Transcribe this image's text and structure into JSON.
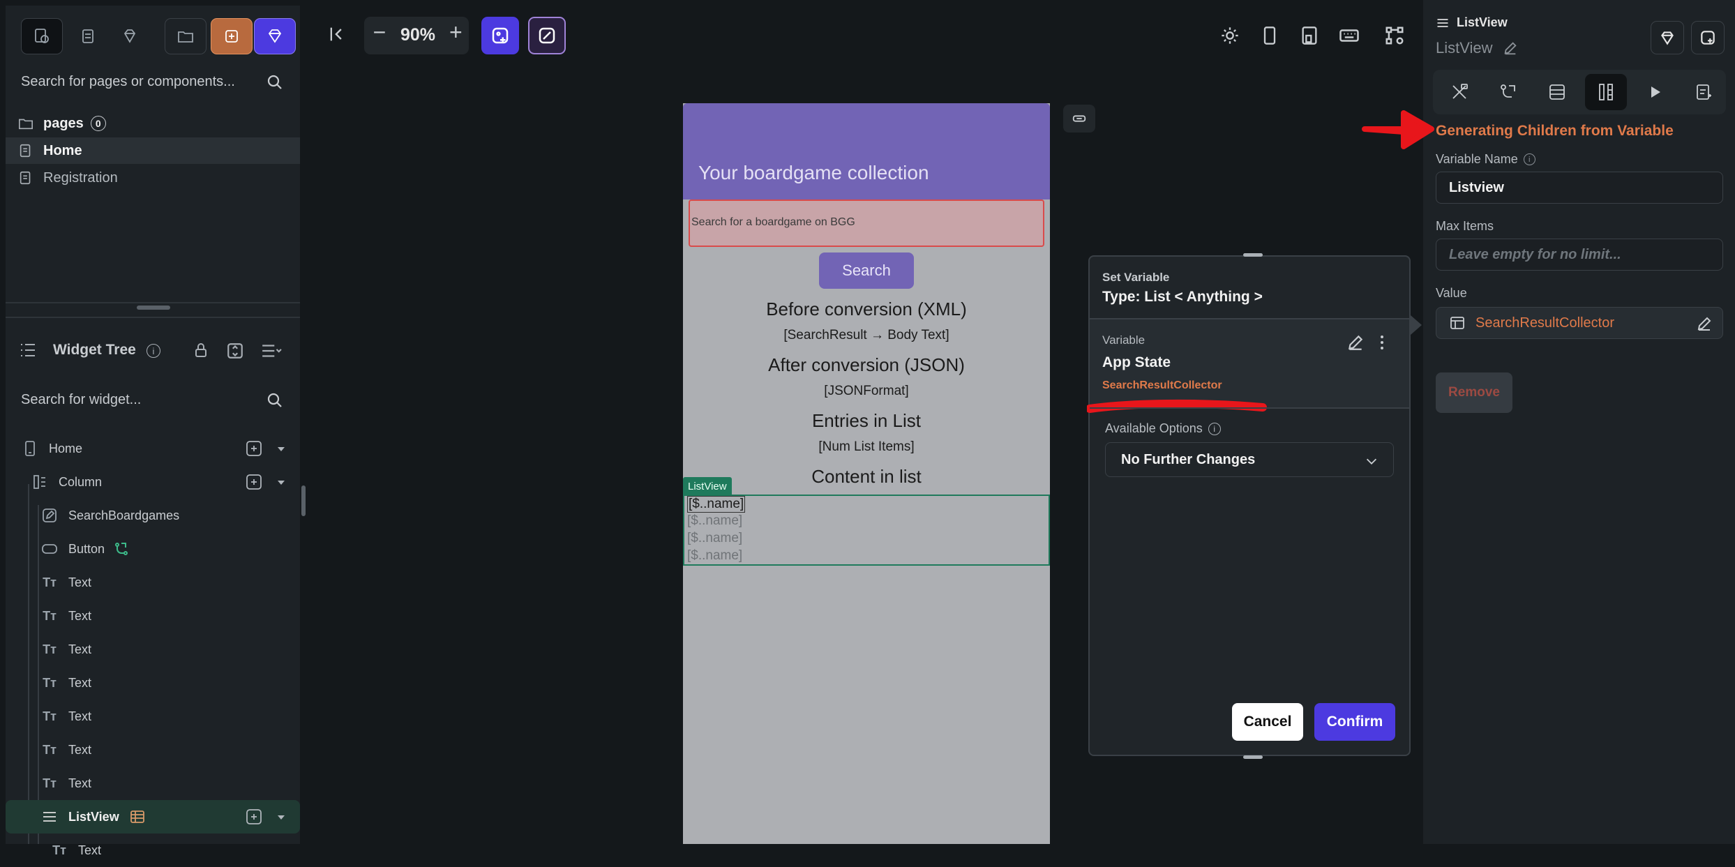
{
  "left_panel": {
    "search_pages_placeholder": "Search for pages or components...",
    "pages_label": "pages",
    "pages_count": "0",
    "pages": [
      "Home",
      "Registration"
    ],
    "widget_tree_title": "Widget Tree",
    "search_widget_placeholder": "Search for widget...",
    "tree": [
      {
        "label": "Home",
        "icon": "phone-icon"
      },
      {
        "label": "Column",
        "icon": "column-icon"
      },
      {
        "label": "SearchBoardgames",
        "icon": "textfield-icon"
      },
      {
        "label": "Button",
        "icon": "button-icon"
      },
      {
        "label": "Text",
        "icon": "text-icon"
      },
      {
        "label": "Text",
        "icon": "text-icon"
      },
      {
        "label": "Text",
        "icon": "text-icon"
      },
      {
        "label": "Text",
        "icon": "text-icon"
      },
      {
        "label": "Text",
        "icon": "text-icon"
      },
      {
        "label": "Text",
        "icon": "text-icon"
      },
      {
        "label": "Text",
        "icon": "text-icon"
      },
      {
        "label": "ListView",
        "icon": "listview-icon"
      },
      {
        "label": "Text",
        "icon": "text-icon"
      }
    ]
  },
  "canvas": {
    "zoom": "90%",
    "minus": "−",
    "plus": "+",
    "phone": {
      "app_title": "Your boardgame collection",
      "search_placeholder": "Search for a boardgame on BGG",
      "search_button": "Search",
      "texts": [
        "Before conversion (XML)",
        "[SearchResult → Body Text]",
        "After conversion (JSON)",
        "[JSONFormat]",
        "Entries in List",
        "[Num List Items]",
        "Content in list"
      ],
      "listview_badge": "ListView",
      "list_items": [
        "[$..name]",
        "[$..name]",
        "[$..name]",
        "[$..name]"
      ]
    }
  },
  "dialog": {
    "header_label": "Set Variable",
    "type_label": "Type: List < Anything >",
    "variable_label": "Variable",
    "source": "App State",
    "variable_name": "SearchResultCollector",
    "options_label": "Available Options",
    "option_selected": "No Further Changes",
    "cancel": "Cancel",
    "confirm": "Confirm"
  },
  "right_panel": {
    "widget_type": "ListView",
    "widget_name": "ListView",
    "section_title": "Generating Children from Variable",
    "variable_name_label": "Variable Name",
    "variable_name_value": "Listview",
    "max_items_label": "Max Items",
    "max_items_placeholder": "Leave empty for no limit...",
    "value_label": "Value",
    "value": "SearchResultCollector",
    "remove": "Remove"
  },
  "colors": {
    "accent": "#4c3ae0",
    "orange": "#e07a4a",
    "annotation_red": "#e8161b",
    "app_bar": "#7264b5",
    "listview_green": "#1f7a5c"
  }
}
